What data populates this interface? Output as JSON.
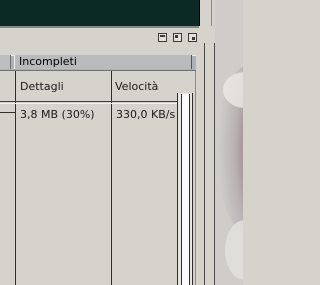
{
  "tabs": [
    {
      "label": "Incompleti"
    }
  ],
  "table": {
    "headers": [
      "Dettagli",
      "Velocità"
    ],
    "rows": [
      {
        "dettagli": "3,8 MB (30%)",
        "velocita": "330,0 KB/s"
      }
    ]
  },
  "colors": {
    "top_bar": "#0b2a26",
    "panel_bg": "#d6d2cc",
    "tab_bg": "#aeb2b3"
  },
  "icons": [
    "minimize-icon",
    "restore-icon",
    "maximize-icon"
  ]
}
